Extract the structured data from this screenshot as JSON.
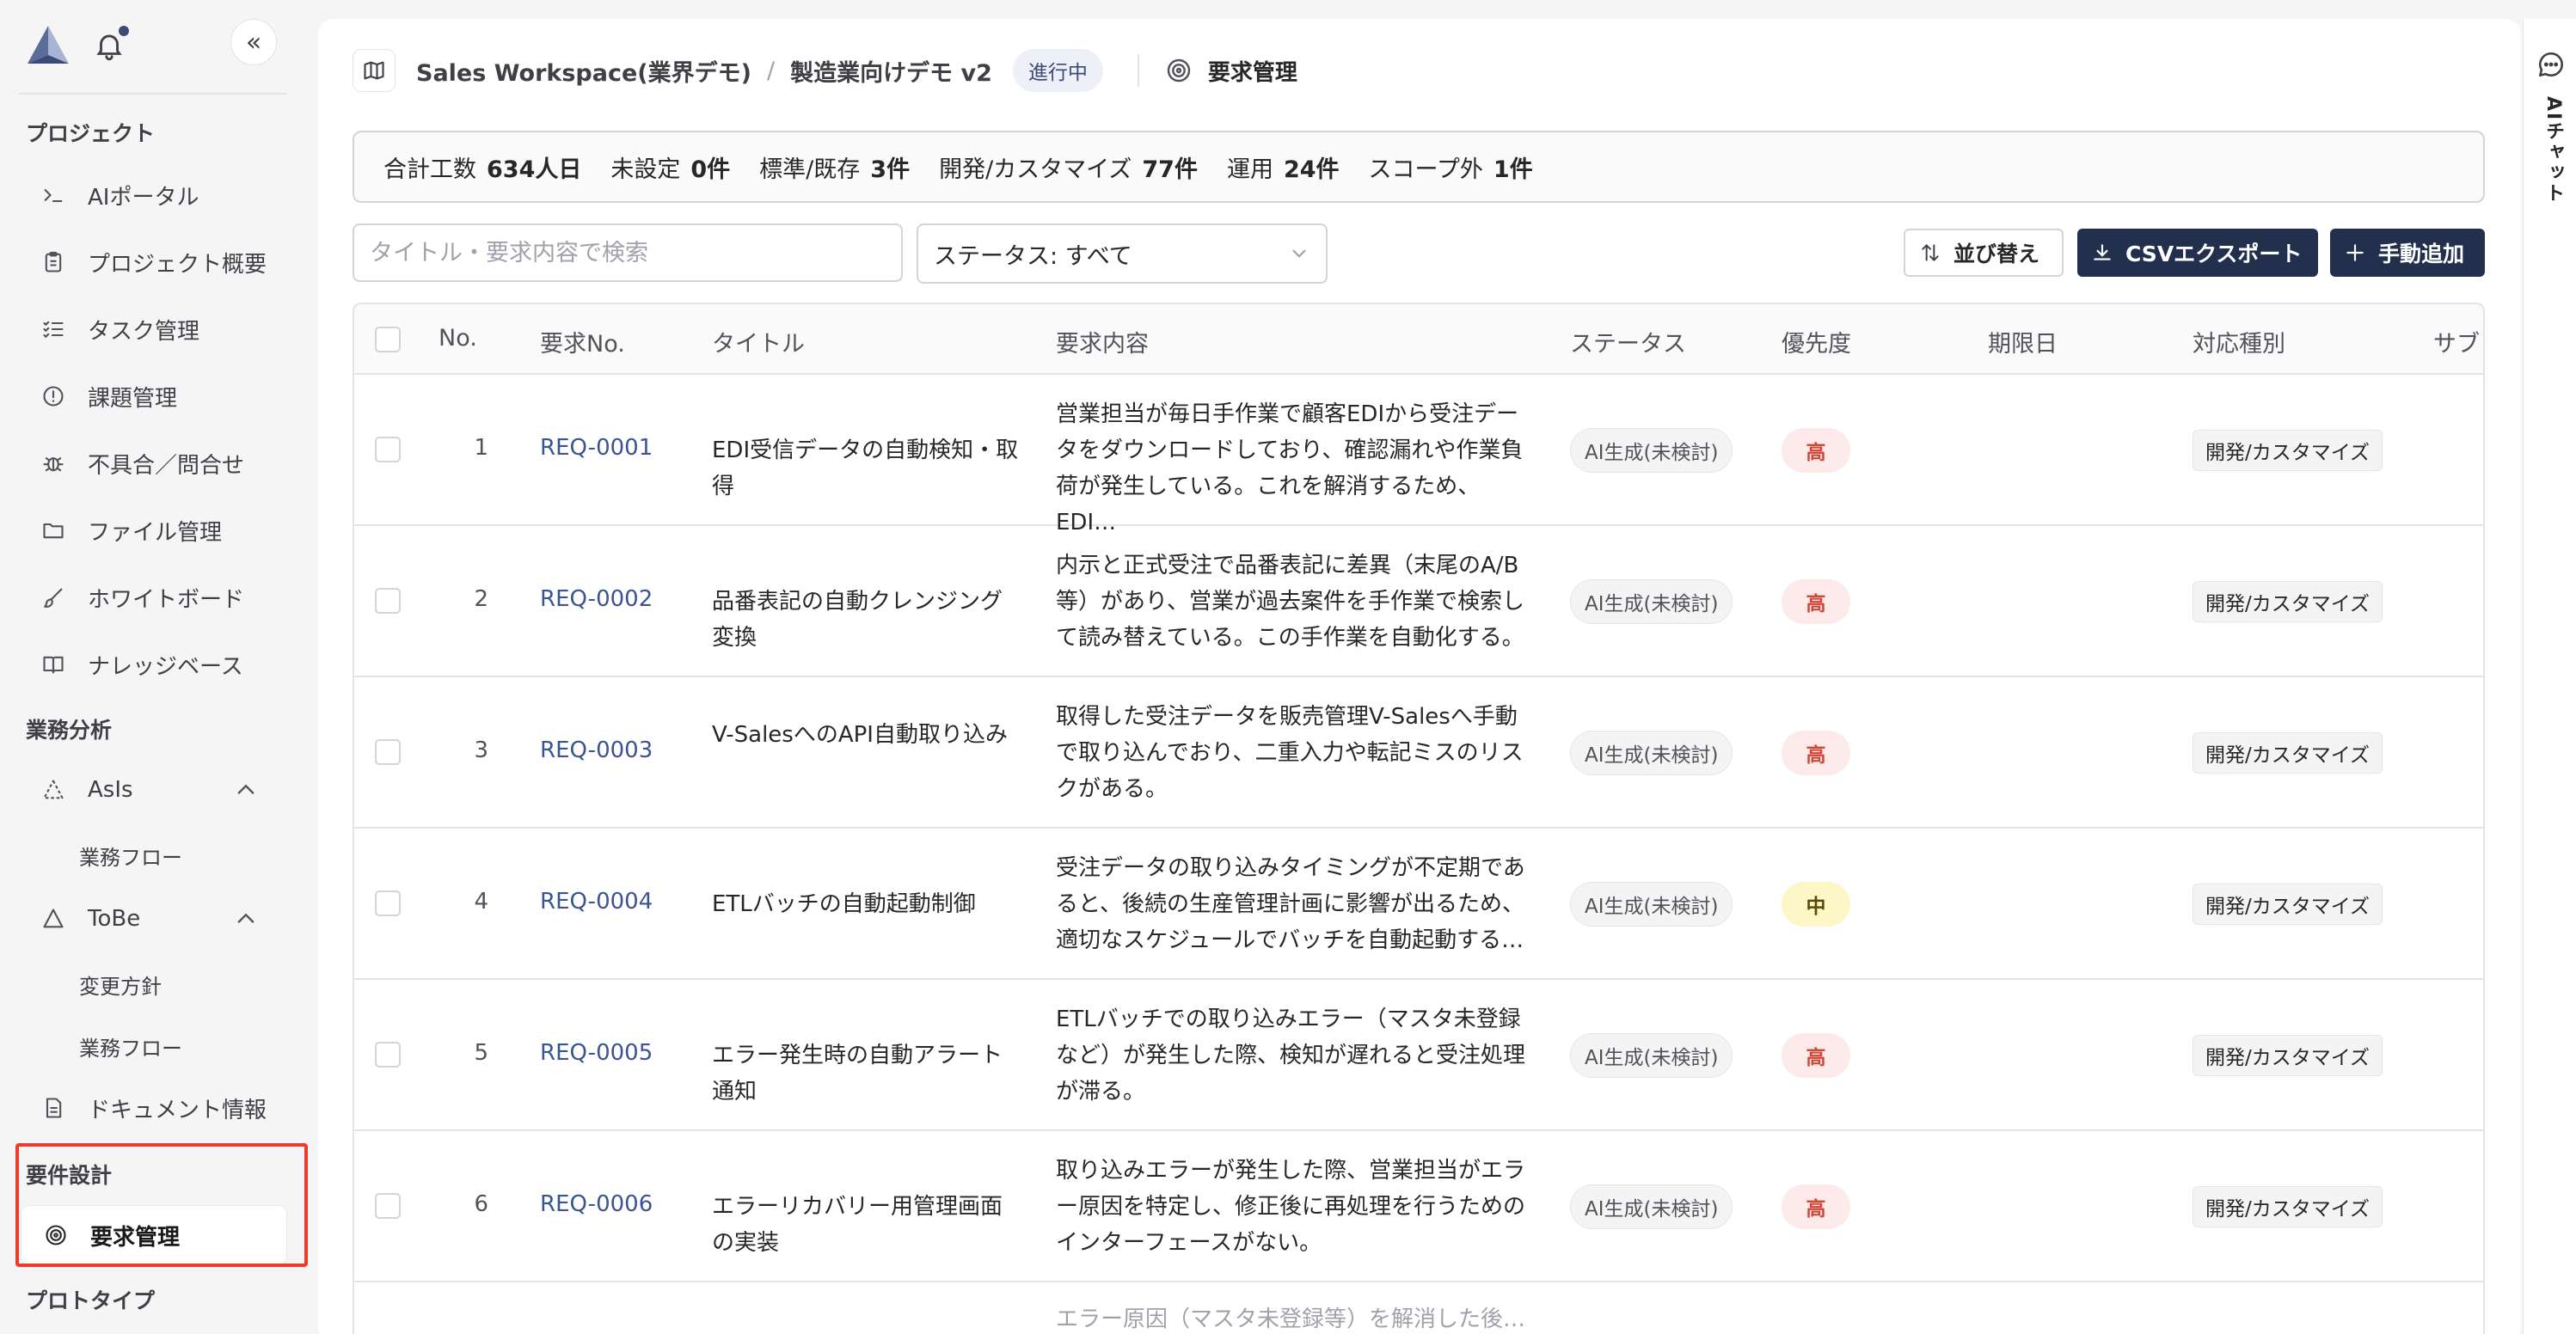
{
  "sidebar": {
    "collapse_label": "«",
    "sections": {
      "project": "プロジェクト",
      "business_analysis": "業務分析",
      "requirements": "要件設計",
      "prototype": "プロトタイプ"
    },
    "items": {
      "ai_portal": "AIポータル",
      "project_overview": "プロジェクト概要",
      "task_management": "タスク管理",
      "issue_management": "課題管理",
      "defects": "不具合／問合せ",
      "files": "ファイル管理",
      "whiteboard": "ホワイトボード",
      "knowledge_base": "ナレッジベース",
      "asis": "AsIs",
      "asis_flow": "業務フロー",
      "tobe": "ToBe",
      "tobe_policy": "変更方針",
      "tobe_flow": "業務フロー",
      "documents": "ドキュメント情報",
      "requirements_mgmt": "要求管理"
    },
    "icons": [
      "terminal-icon",
      "clipboard-icon",
      "list-checks-icon",
      "alert-circle-icon",
      "bug-icon",
      "folder-icon",
      "brush-icon",
      "book-open-icon",
      "triangle-icon",
      "file-text-icon",
      "target-icon"
    ]
  },
  "header": {
    "workspace": "Sales Workspace(業界デモ)",
    "separator": "/",
    "project": "製造業向けデモ v2",
    "status_badge": "進行中",
    "page": "要求管理"
  },
  "summary": {
    "total_label": "合計工数",
    "total_value": "634人日",
    "unset_label": "未設定",
    "unset_value": "0件",
    "standard_label": "標準/既存",
    "standard_value": "3件",
    "dev_label": "開発/カスタマイズ",
    "dev_value": "77件",
    "ops_label": "運用",
    "ops_value": "24件",
    "out_label": "スコープ外",
    "out_value": "1件"
  },
  "toolbar": {
    "search_placeholder": "タイトル・要求内容で検索",
    "status_filter": "ステータス: すべて",
    "sort_label": "並び替え",
    "csv_label": "CSVエクスポート",
    "add_label": "手動追加"
  },
  "table": {
    "headers": {
      "no": "No.",
      "req_no": "要求No.",
      "title": "タイトル",
      "content": "要求内容",
      "status": "ステータス",
      "priority": "優先度",
      "due": "期限日",
      "type": "対応種別",
      "sub": "サブ"
    },
    "rows": [
      {
        "no": "1",
        "req_no": "REQ-0001",
        "title": "EDI受信データの自動検知・取得",
        "content": "営業担当が毎日手作業で顧客EDIから受注データをダウンロードしており、確認漏れや作業負荷が発生している。これを解消するため、EDI…",
        "status": "AI生成(未検討)",
        "priority": "高",
        "priority_level": "high",
        "due": "",
        "type": "開発/カスタマイズ"
      },
      {
        "no": "2",
        "req_no": "REQ-0002",
        "title": "品番表記の自動クレンジング変換",
        "content": "内示と正式受注で品番表記に差異（末尾のA/B等）があり、営業が過去案件を手作業で検索して読み替えている。この手作業を自動化する。",
        "status": "AI生成(未検討)",
        "priority": "高",
        "priority_level": "high",
        "due": "",
        "type": "開発/カスタマイズ"
      },
      {
        "no": "3",
        "req_no": "REQ-0003",
        "title": "V-SalesへのAPI自動取り込み",
        "content": "取得した受注データを販売管理V-Salesへ手動で取り込んでおり、二重入力や転記ミスのリスクがある。",
        "status": "AI生成(未検討)",
        "priority": "高",
        "priority_level": "high",
        "due": "",
        "type": "開発/カスタマイズ"
      },
      {
        "no": "4",
        "req_no": "REQ-0004",
        "title": "ETLバッチの自動起動制御",
        "content": "受注データの取り込みタイミングが不定期であると、後続の生産管理計画に影響が出るため、適切なスケジュールでバッチを自動起動する…",
        "status": "AI生成(未検討)",
        "priority": "中",
        "priority_level": "mid",
        "due": "",
        "type": "開発/カスタマイズ"
      },
      {
        "no": "5",
        "req_no": "REQ-0005",
        "title": "エラー発生時の自動アラート通知",
        "content": "ETLバッチでの取り込みエラー（マスタ未登録など）が発生した際、検知が遅れると受注処理が滞る。",
        "status": "AI生成(未検討)",
        "priority": "高",
        "priority_level": "high",
        "due": "",
        "type": "開発/カスタマイズ"
      },
      {
        "no": "6",
        "req_no": "REQ-0006",
        "title": "エラーリカバリー用管理画面の実装",
        "content": "取り込みエラーが発生した際、営業担当がエラー原因を特定し、修正後に再処理を行うためのインターフェースがない。",
        "status": "AI生成(未検討)",
        "priority": "高",
        "priority_level": "high",
        "due": "",
        "type": "開発/カスタマイズ"
      }
    ],
    "partial_row_text": "エラー原因（マスタ未登録等）を解消した後…"
  },
  "ai_chat": {
    "label": "AIチャット"
  },
  "colors": {
    "accent": "#22304d",
    "link": "#3b5590",
    "priority_high_bg": "#fdeaea",
    "priority_high_fg": "#d2463c",
    "priority_mid_bg": "#fdf7c7",
    "highlight": "#ef3b2c"
  }
}
